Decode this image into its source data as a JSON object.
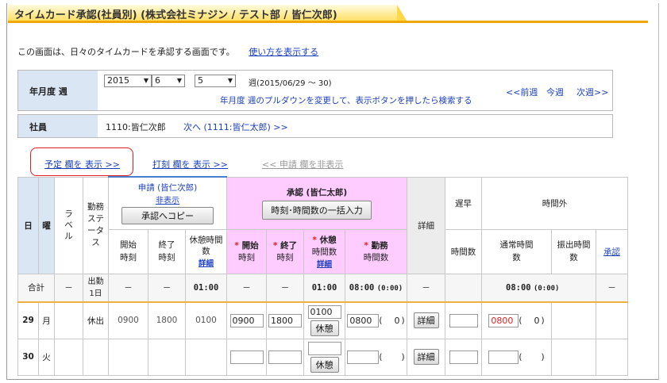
{
  "header": {
    "title": "タイムカード承認(社員別) (株式会社ミナジン / テスト部 / 皆仁次郎)"
  },
  "intro": {
    "text": "この画面は、日々のタイムカードを承認する画面です。",
    "help_link": "使い方を表示する"
  },
  "period": {
    "label": "年月度 週",
    "year": "2015",
    "month": "6",
    "week": "5",
    "range": "週(2015/06/29 ～ 30)",
    "hint": "年月度 週のプルダウンを変更して、表示ボタンを押したら検索する",
    "prev": "<<前週",
    "this": "今週",
    "next": "次週>>"
  },
  "employee": {
    "label": "社員",
    "value": "1110:皆仁次郎",
    "next": "次へ (1111:皆仁太郎) >>"
  },
  "tabs": {
    "plan": "予定 欄を 表示 >>",
    "stamp": "打刻 欄を 表示 >>",
    "apply_hide": "<< 申請 欄を非表示"
  },
  "table": {
    "h_day": "日",
    "h_dow": "曜",
    "h_label": "ラベル",
    "h_status": "勤務ステータス",
    "h_apply": "申請 (皆仁次郎)",
    "h_hide": "非表示",
    "h_copy": "承認へコピー",
    "h_approve": "承認 (皆仁太郎)",
    "h_bulk": "時刻･時間数の一括入力",
    "h_detail": "詳細",
    "h_late": "遅早",
    "h_overtime": "時間外",
    "h_start": "開始時刻",
    "h_end": "終了時刻",
    "h_break": "休憩時間数",
    "h_break_detail": "詳細",
    "h_a_start": "開始",
    "h_a_start2": "時刻",
    "h_a_end": "終了",
    "h_a_end2": "時刻",
    "h_a_break": "休憩",
    "h_a_break2": "時間数",
    "h_a_work": "勤務",
    "h_a_work2": "時間数",
    "h_late_hours": "時間数",
    "h_normal": "通常時間数",
    "h_transfer": "振出時間数",
    "h_approve_link": "承認",
    "total": {
      "label": "合計",
      "dash": "－",
      "status": "出勤1日",
      "break": "01:00",
      "a_break": "01:00",
      "a_work": "08:00",
      "a_work_sub": "(0:00)",
      "ot": "08:00",
      "ot_sub": "(0:00)"
    },
    "rows": [
      {
        "day": "29",
        "dow": "月",
        "status": "休出",
        "start": "0900",
        "end": "1800",
        "break": "0100",
        "a_start": "0900",
        "a_end": "1800",
        "a_break": "0100",
        "break_btn": "休憩",
        "a_work": "0800",
        "a_work_paren": "(",
        "a_work_zero": "0",
        "a_work_close": ")",
        "detail": "詳細",
        "ot": "0800",
        "ot_zero": "0"
      },
      {
        "day": "30",
        "dow": "火",
        "status": "",
        "start": "",
        "end": "",
        "break": "",
        "a_start": "",
        "a_end": "",
        "a_break": "",
        "break_btn": "休憩",
        "a_work": "",
        "a_work_paren": "(",
        "a_work_zero": "",
        "a_work_close": ")",
        "detail": "詳細",
        "ot": "",
        "ot_zero": ""
      }
    ]
  },
  "colors": {
    "title_bar": "#ffe066",
    "accent_orange": "#f0a800",
    "header_blue": "#dbe6f5",
    "header_pink": "#ffccff",
    "link": "#1a3fc0",
    "alert_red": "#e02020"
  }
}
